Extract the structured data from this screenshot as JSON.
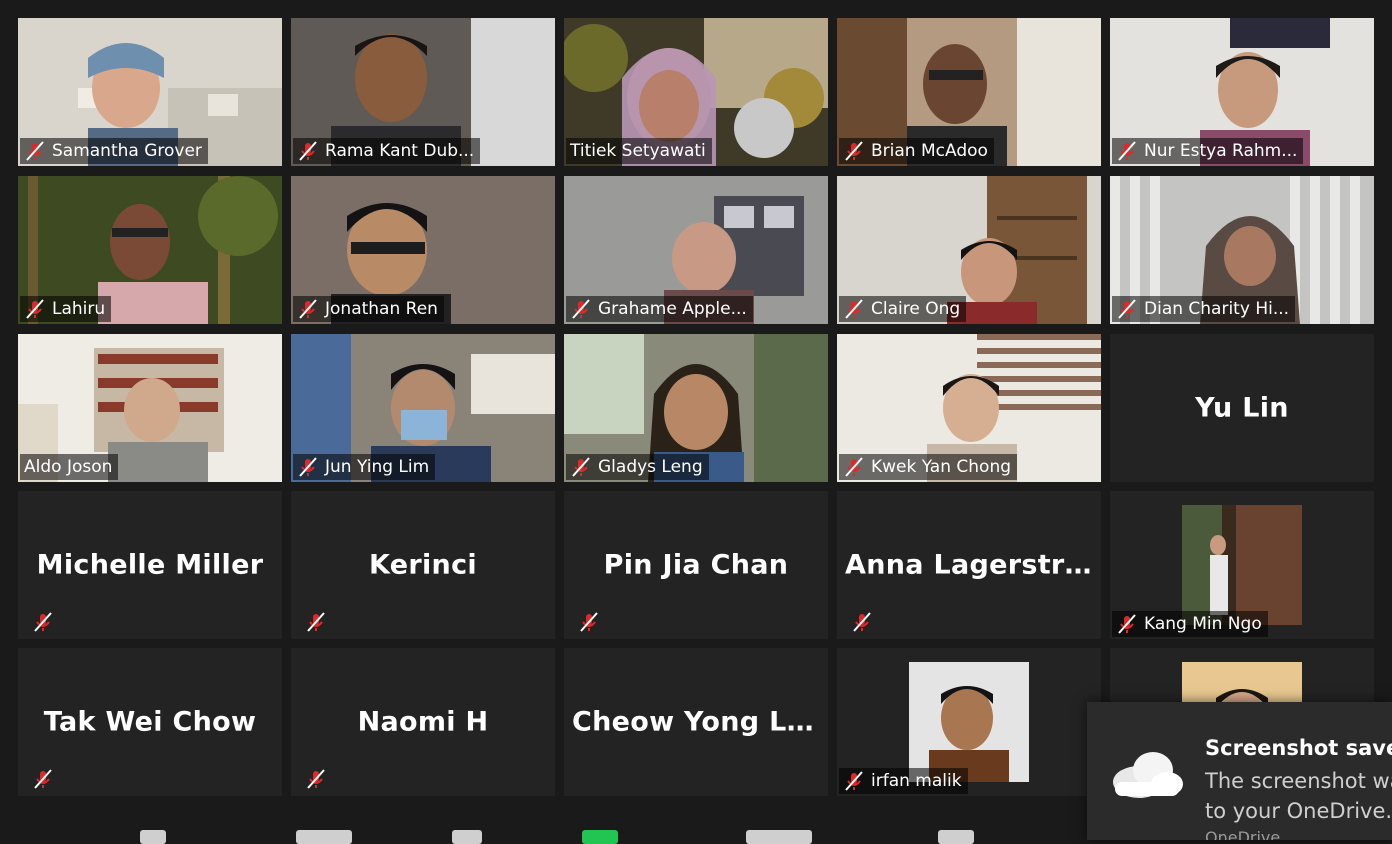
{
  "participants": [
    {
      "name": "Samantha Grover",
      "muted": true
    },
    {
      "name": "Rama Kant Dub...",
      "muted": true
    },
    {
      "name": "Titiek Setyawati",
      "muted": false
    },
    {
      "name": "Brian McAdoo",
      "muted": true
    },
    {
      "name": "Nur Estya Rahm...",
      "muted": true
    },
    {
      "name": "Lahiru",
      "muted": true
    },
    {
      "name": "Jonathan Ren",
      "muted": true
    },
    {
      "name": "Grahame Apple...",
      "muted": true
    },
    {
      "name": "Claire Ong",
      "muted": true
    },
    {
      "name": "Dian Charity Hi...",
      "muted": true
    },
    {
      "name": "Aldo Joson",
      "muted": false
    },
    {
      "name": "Jun Ying Lim",
      "muted": true
    },
    {
      "name": "Gladys Leng",
      "muted": true
    },
    {
      "name": "Kwek Yan Chong",
      "muted": true
    },
    {
      "name": "Yu Lin",
      "muted": false
    },
    {
      "name": "Michelle Miller",
      "muted": true
    },
    {
      "name": "Kerinci",
      "muted": true
    },
    {
      "name": "Pin Jia Chan",
      "muted": true
    },
    {
      "name": "Anna  Lagerstro...",
      "muted": true
    },
    {
      "name": "Kang Min Ngo",
      "muted": true
    },
    {
      "name": "Tak Wei Chow",
      "muted": true
    },
    {
      "name": "Naomi H",
      "muted": true
    },
    {
      "name": "Cheow  Yong  Lia...",
      "muted": false
    },
    {
      "name": "irfan malik",
      "muted": true
    },
    {
      "name": "",
      "muted": false
    }
  ],
  "toast": {
    "title": "Screenshot saved",
    "message": "The screenshot was added to your OneDrive.",
    "source": "OneDrive"
  },
  "colors": {
    "background": "#1a1a1a",
    "tile": "#232323",
    "muted_red": "#e02828"
  }
}
